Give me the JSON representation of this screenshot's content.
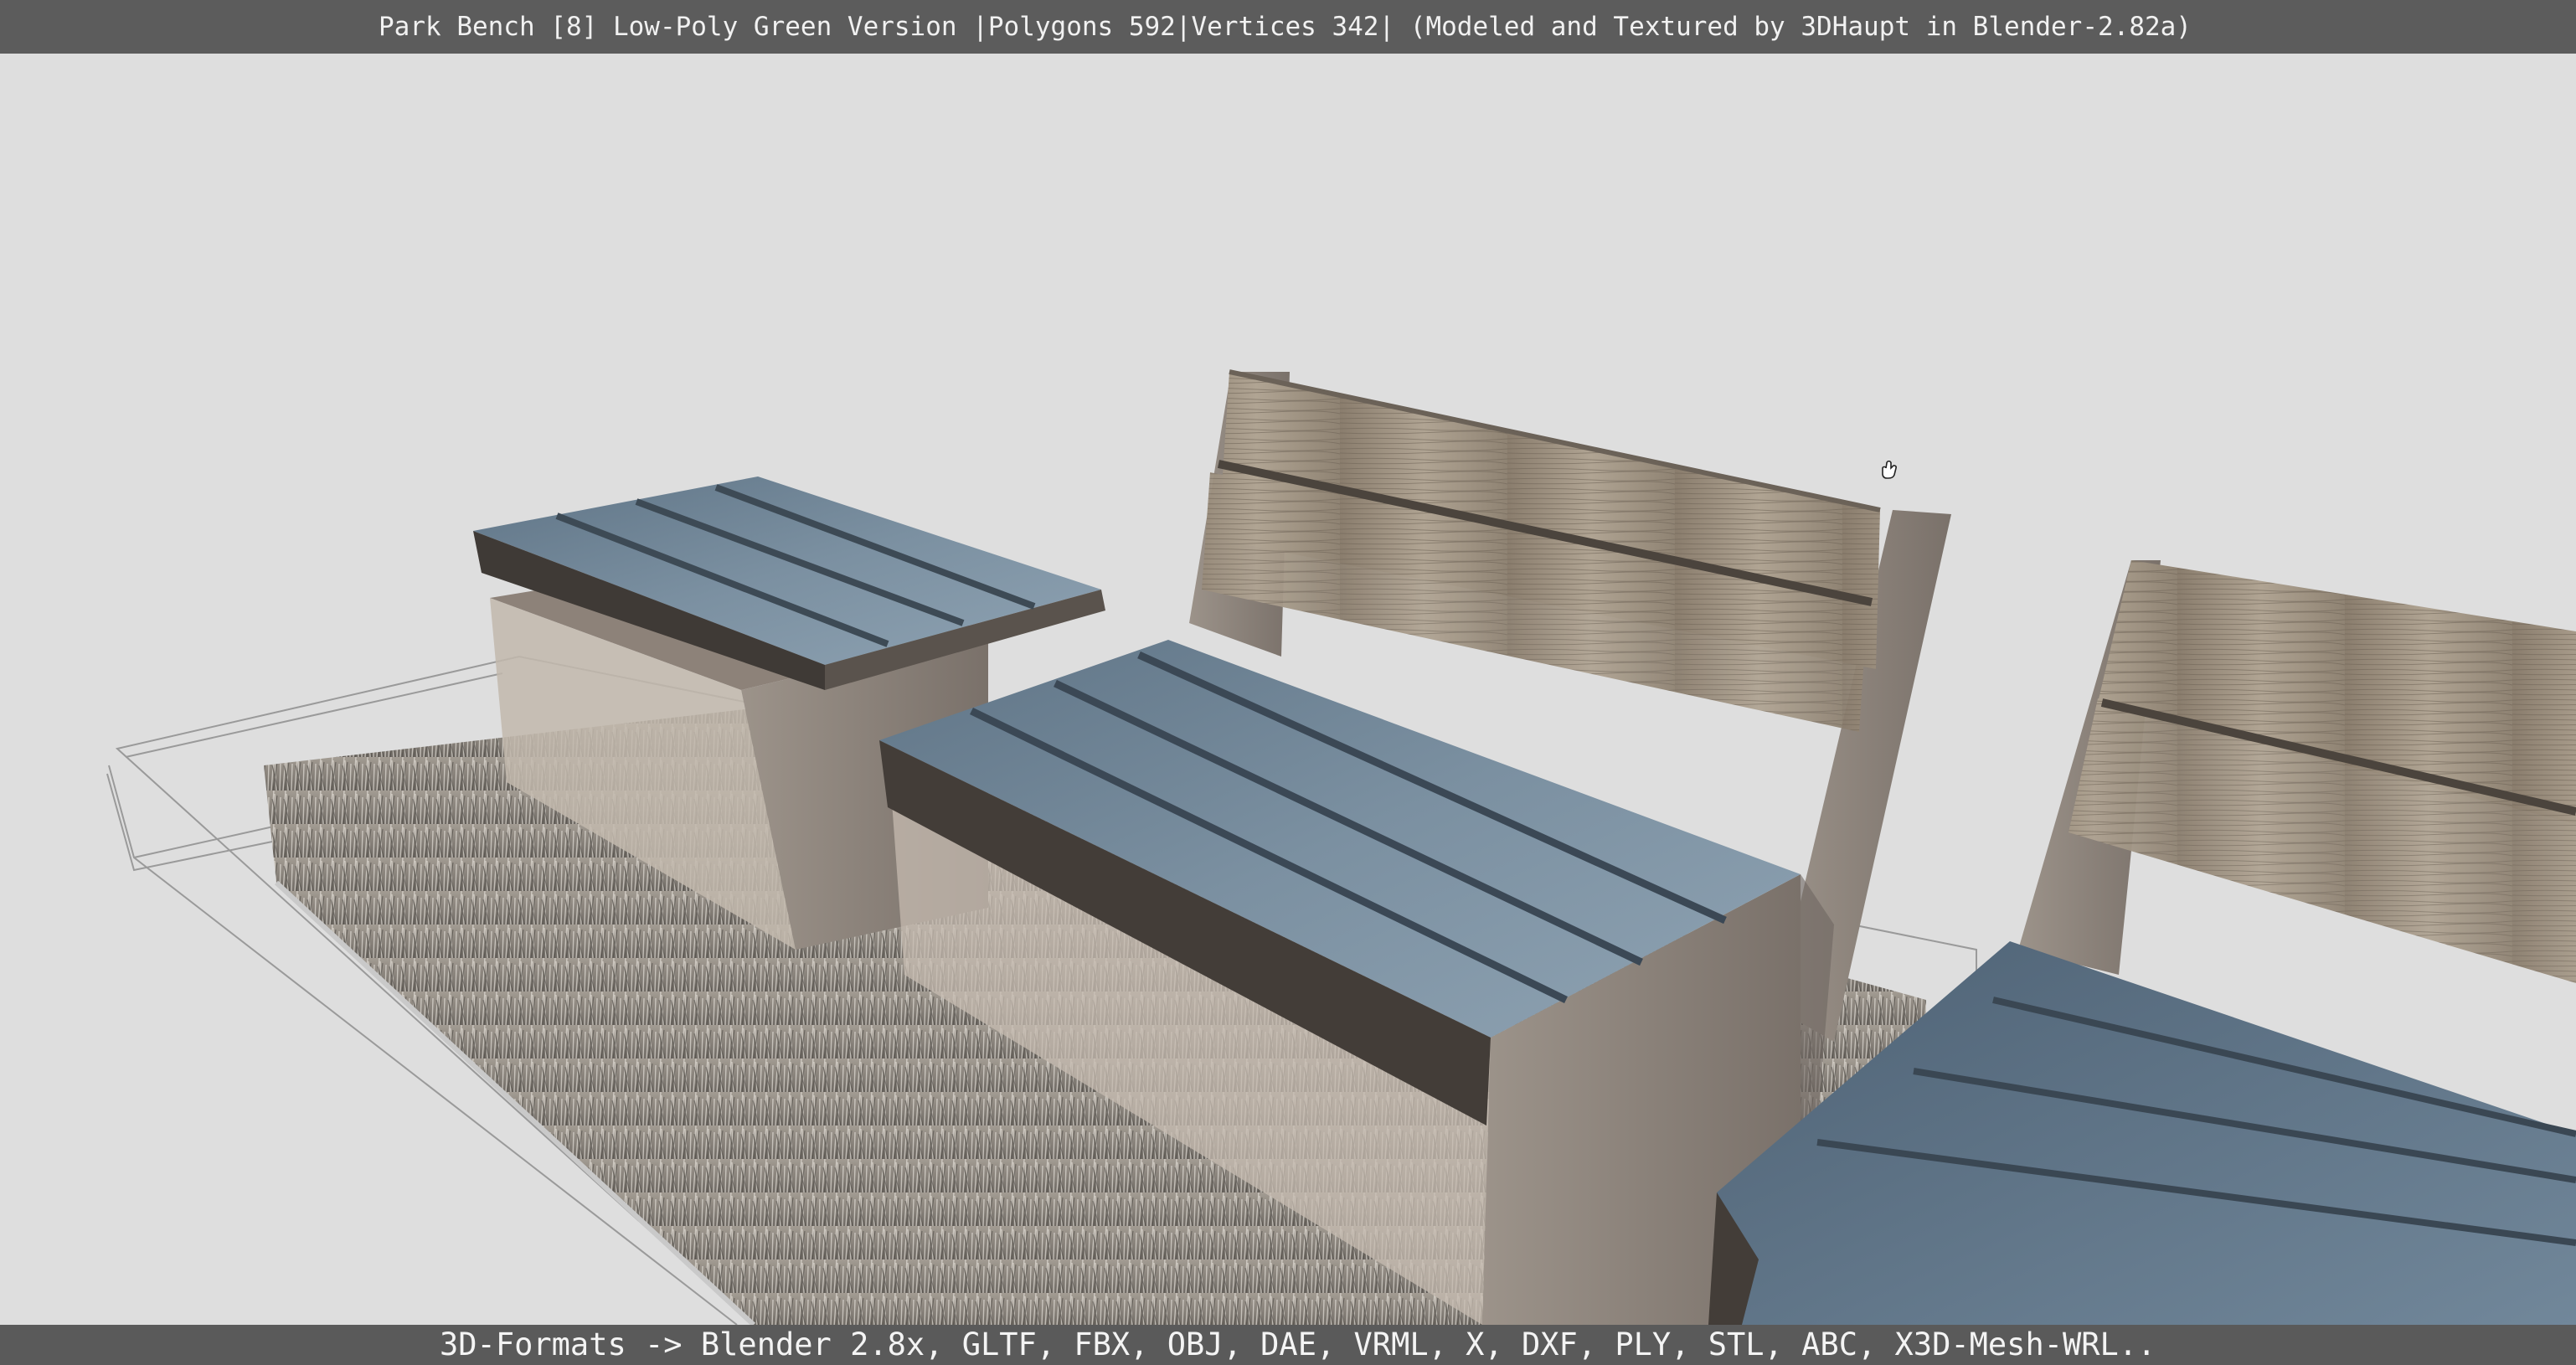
{
  "window": {
    "title": "Park Bench [8] Low-Poly Green Version |Polygons 592|Vertices 342| (Modeled and Textured by 3DHaupt in Blender-2.82a)"
  },
  "scene": {
    "objects": [
      "wireframe-platform",
      "grass-patch",
      "stool-bench",
      "bench-center",
      "bench-right"
    ],
    "cursor": "hand-cursor-icon"
  },
  "footer": {
    "formats_text": "3D-Formats -> Blender 2.8x, GLTF, FBX, OBJ, DAE, VRML, X, DXF, PLY, STL, ABC, X3D-Mesh-WRL.."
  },
  "colors": {
    "background": "#dedede",
    "titlebar": "#5c5c5c",
    "footer": "#5a5a5a",
    "seat_top": "#6e8496",
    "backrest_wood": "#a89c8c",
    "frame": "#8d847c",
    "grass": "#9a938b"
  }
}
